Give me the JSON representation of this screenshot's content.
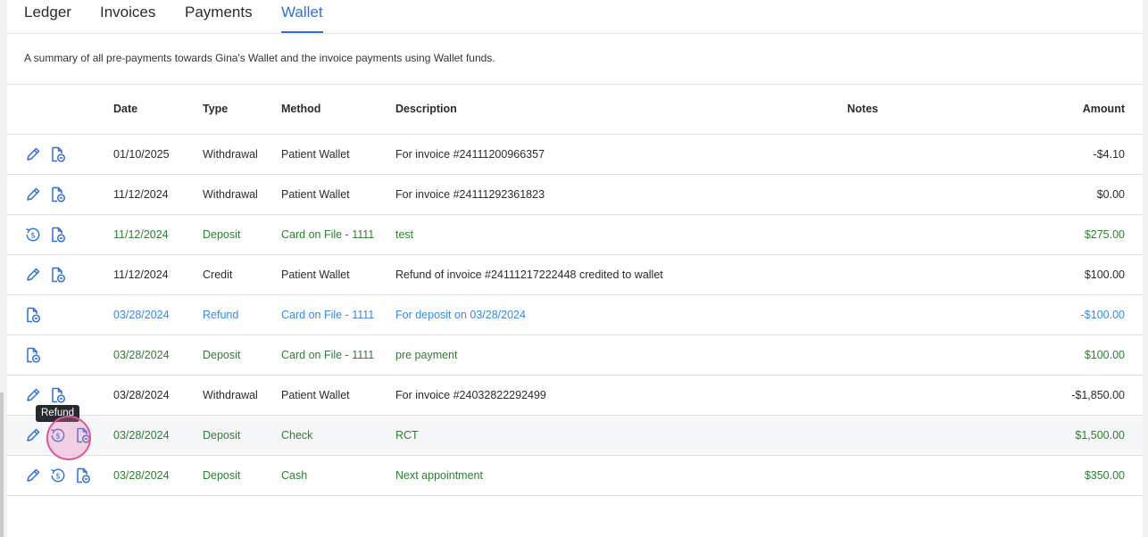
{
  "tabs": [
    "Ledger",
    "Invoices",
    "Payments",
    "Wallet"
  ],
  "active_tab": "Wallet",
  "summary": "A summary of all pre-payments towards Gina's Wallet and the invoice payments using Wallet funds.",
  "columns": {
    "date": "Date",
    "type": "Type",
    "method": "Method",
    "description": "Description",
    "notes": "Notes",
    "amount": "Amount"
  },
  "rows": [
    {
      "icons": [
        "pencil-icon",
        "invoice-doc-icon"
      ],
      "date": "01/10/2025",
      "type": "Withdrawal",
      "method": "Patient Wallet",
      "description": "For invoice #24111200966357",
      "notes": "",
      "amount": "-$4.10",
      "color": "dark"
    },
    {
      "icons": [
        "pencil-icon",
        "invoice-doc-icon"
      ],
      "date": "11/12/2024",
      "type": "Withdrawal",
      "method": "Patient Wallet",
      "description": "For invoice #24111292361823",
      "notes": "",
      "amount": "$0.00",
      "color": "dark"
    },
    {
      "icons": [
        "refund-icon",
        "invoice-doc-icon"
      ],
      "date": "11/12/2024",
      "type": "Deposit",
      "method": "Card on File - 1111",
      "description": "test",
      "notes": "",
      "amount": "$275.00",
      "color": "green"
    },
    {
      "icons": [
        "pencil-icon",
        "invoice-doc-icon"
      ],
      "date": "11/12/2024",
      "type": "Credit",
      "method": "Patient Wallet",
      "description": "Refund of invoice #24111217222448 credited to wallet",
      "notes": "",
      "amount": "$100.00",
      "color": "dark"
    },
    {
      "icons": [
        "invoice-doc-icon"
      ],
      "date": "03/28/2024",
      "type": "Refund",
      "method": "Card on File - 1111",
      "description": "For deposit on 03/28/2024",
      "notes": "",
      "amount": "-$100.00",
      "color": "blue"
    },
    {
      "icons": [
        "invoice-doc-icon"
      ],
      "date": "03/28/2024",
      "type": "Deposit",
      "method": "Card on File - 1111",
      "description": "pre payment",
      "notes": "",
      "amount": "$100.00",
      "color": "green"
    },
    {
      "icons": [
        "pencil-icon",
        "invoice-doc-icon"
      ],
      "date": "03/28/2024",
      "type": "Withdrawal",
      "method": "Patient Wallet",
      "description": "For invoice #24032822292499",
      "notes": "",
      "amount": "-$1,850.00",
      "color": "dark"
    },
    {
      "icons": [
        "pencil-icon",
        "refund-icon",
        "invoice-doc-icon"
      ],
      "date": "03/28/2024",
      "type": "Deposit",
      "method": "Check",
      "description": "RCT",
      "notes": "",
      "amount": "$1,500.00",
      "color": "green"
    },
    {
      "icons": [
        "pencil-icon",
        "refund-icon",
        "invoice-doc-icon"
      ],
      "date": "03/28/2024",
      "type": "Deposit",
      "method": "Cash",
      "description": "Next appointment",
      "notes": "",
      "amount": "$350.00",
      "color": "green"
    }
  ],
  "tooltip": "Refund",
  "colors": {
    "accent": "#2e6fd8",
    "deposit": "#2e7d32",
    "refund": "#3a86e0",
    "click_highlight": "#e05597"
  }
}
